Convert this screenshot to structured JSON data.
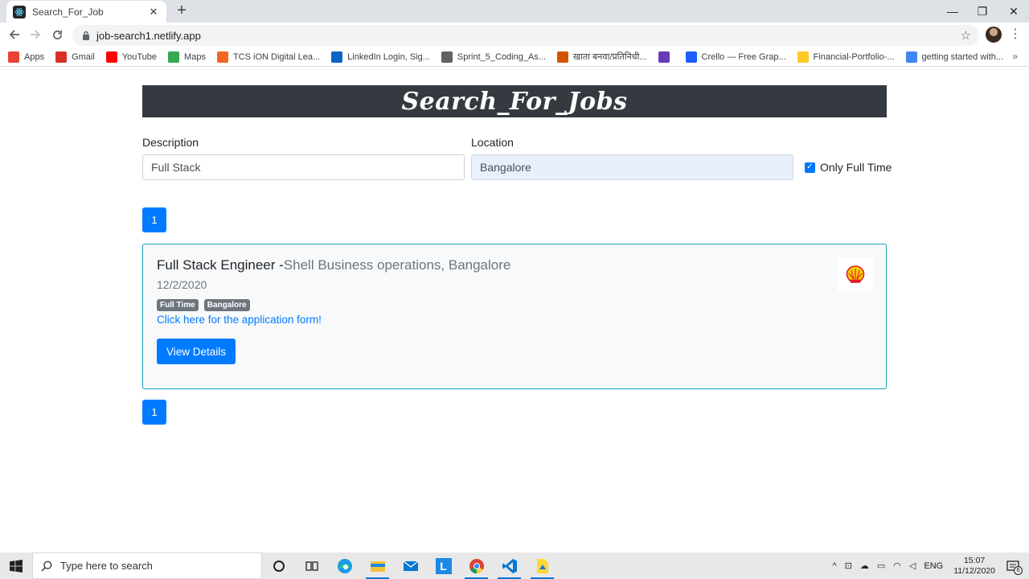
{
  "browser": {
    "tab_title": "Search_For_Job",
    "tab_close": "✕",
    "new_tab": "+",
    "url": "job-search1.netlify.app",
    "window_controls": [
      "—",
      "❐",
      "✕"
    ]
  },
  "bookmarks": [
    {
      "label": "Apps",
      "icon": "apps-grid-icon",
      "color": "#ea4335"
    },
    {
      "label": "Gmail",
      "icon": "gmail-icon",
      "color": "#d93025"
    },
    {
      "label": "YouTube",
      "icon": "youtube-icon",
      "color": "#ff0000"
    },
    {
      "label": "Maps",
      "icon": "maps-icon",
      "color": "#34a853"
    },
    {
      "label": "TCS iON Digital Lea...",
      "icon": "tcs-icon",
      "color": "#f26522"
    },
    {
      "label": "LinkedIn Login, Sig...",
      "icon": "linkedin-icon",
      "color": "#0a66c2"
    },
    {
      "label": "Sprint_5_Coding_As...",
      "icon": "document-icon",
      "color": "#5f6368"
    },
    {
      "label": "खाता बनवा/प्रतिनिधी...",
      "icon": "emblem-icon",
      "color": "#d35400"
    },
    {
      "label": "",
      "icon": "forms-icon",
      "color": "#673ab7"
    },
    {
      "label": "Crello — Free Grap...",
      "icon": "crello-icon",
      "color": "#1e5eff"
    },
    {
      "label": "Financial-Portfolio-...",
      "icon": "firebase-icon",
      "color": "#ffca28"
    },
    {
      "label": "getting started with...",
      "icon": "google-icon",
      "color": "#4285f4"
    }
  ],
  "bookmarks_more": "»",
  "page": {
    "banner_title": "Search_For_Jobs",
    "description_label": "Description",
    "description_value": "Full Stack",
    "location_label": "Location",
    "location_value": "Bangalore",
    "full_time_label": "Only Full Time",
    "full_time_checked": true,
    "pagination_top": "1",
    "pagination_bottom": "1"
  },
  "job": {
    "title": "Full Stack Engineer -",
    "company_location": "Shell Business operations, Bangalore",
    "date": "12/2/2020",
    "badges": [
      "Full Time",
      "Bangalore"
    ],
    "apply_link": "Click here for the application form!",
    "view_button": "View Details",
    "logo": "shell-logo-icon"
  },
  "taskbar": {
    "search_placeholder": "Type here to search",
    "apps": [
      "cortana-icon",
      "task-view-icon",
      "edge-icon",
      "file-explorer-icon",
      "mail-icon",
      "l-app-icon",
      "chrome-icon",
      "vscode-icon",
      "files-icon"
    ],
    "language": "ENG",
    "time": "15:07",
    "date": "11/12/2020",
    "notification_count": "6"
  },
  "colors": {
    "banner_bg": "#343a40",
    "primary": "#007bff",
    "card_border": "#17a2b8",
    "badge_bg": "#6c757d"
  }
}
